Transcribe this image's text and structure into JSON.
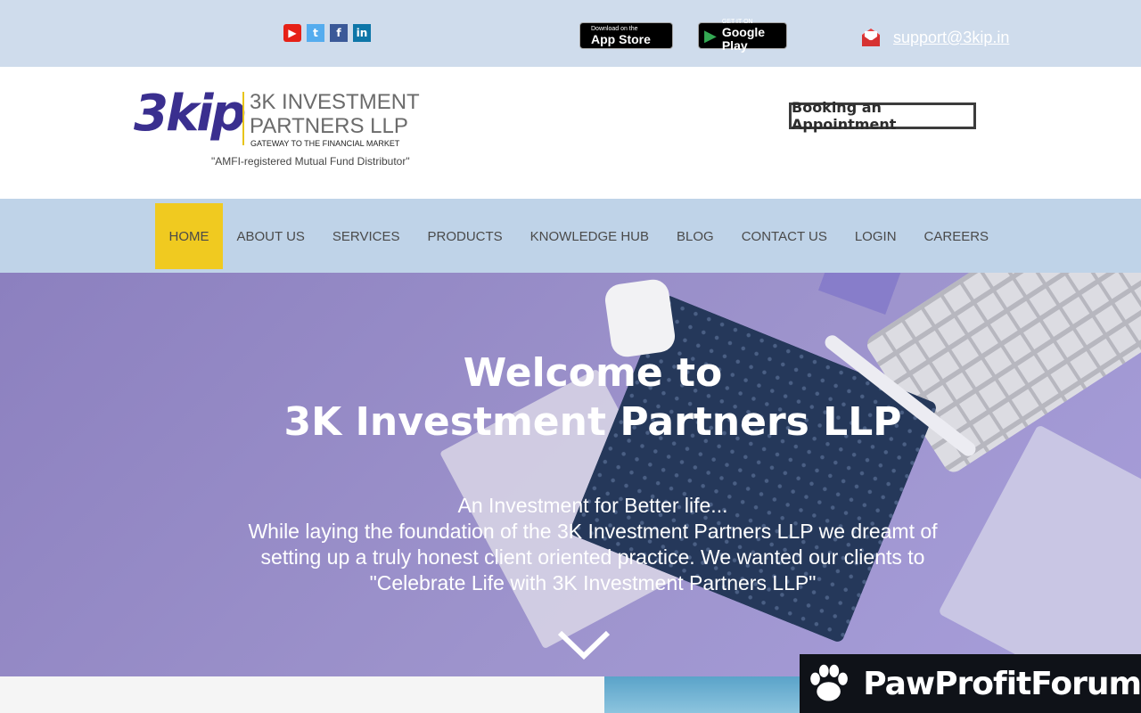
{
  "topbar": {
    "social_icons": [
      "youtube-icon",
      "twitter-icon",
      "facebook-icon",
      "linkedin-icon"
    ],
    "social_glyphs": {
      "youtube": "▶",
      "twitter": "t",
      "facebook": "f",
      "linkedin": "in"
    },
    "app_store": {
      "small": "Download on the",
      "big": "App Store"
    },
    "google_play": {
      "small": "GET IT ON",
      "big": "Google Play"
    },
    "email": "support@3kip.in"
  },
  "header": {
    "logo_mark": "3kip",
    "logo_name_line1": "3K INVESTMENT",
    "logo_name_line2": "PARTNERS LLP",
    "logo_tagline": "GATEWAY TO THE FINANCIAL MARKET",
    "logo_amfi": "\"AMFI-registered Mutual Fund Distributor\"",
    "booking_button": "Booking an Appointment"
  },
  "nav": {
    "items": [
      {
        "label": "HOME",
        "active": true
      },
      {
        "label": "ABOUT US"
      },
      {
        "label": "SERVICES"
      },
      {
        "label": "PRODUCTS"
      },
      {
        "label": "KNOWLEDGE HUB"
      },
      {
        "label": "BLOG"
      },
      {
        "label": "CONTACT US"
      },
      {
        "label": "LOGIN"
      },
      {
        "label": "CAREERS"
      }
    ]
  },
  "hero": {
    "title_line1": "Welcome to",
    "title_line2": "3K Investment Partners LLP",
    "sub_line1": "An Investment for Better life...",
    "sub_line2": "While laying the foundation of the 3K Investment Partners LLP we dreamt of",
    "sub_line3": "setting up a truly honest client oriented practice. We wanted our clients to",
    "sub_line4": "\"Celebrate Life with 3K Investment Partners LLP\""
  },
  "watermark": {
    "text": "PawProfitForum"
  },
  "colors": {
    "topbar": "#cfdcec",
    "nav": "#bfd3e8",
    "nav_active": "#f0ca20",
    "hero": "#9d93cc",
    "brand_purple": "#3a2f8f"
  }
}
